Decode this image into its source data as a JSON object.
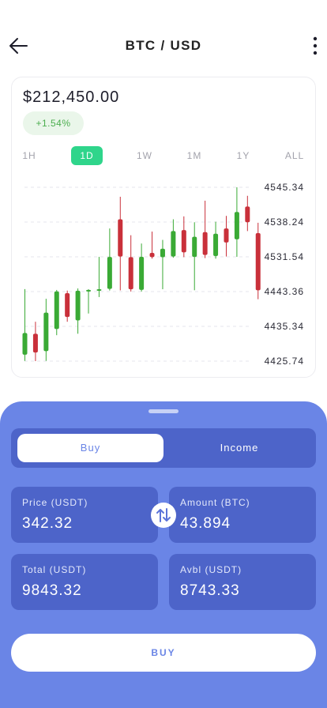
{
  "header": {
    "title": "BTC / USD",
    "back_icon": "arrow-left-icon",
    "more_icon": "vertical-dots-icon"
  },
  "market": {
    "price": "$212,450.00",
    "change": "+1.54%"
  },
  "timeframes": {
    "items": [
      "1H",
      "1D",
      "1W",
      "1M",
      "1Y",
      "ALL"
    ],
    "selected": "1D"
  },
  "chart_data": {
    "type": "candlestick",
    "y_ticks": [
      "4545.34",
      "4538.24",
      "4531.54",
      "4443.36",
      "4435.34",
      "4425.74"
    ],
    "candles": [
      {
        "o": 4427.5,
        "c": 4433.5,
        "h": 4449.5,
        "l": 4425.8,
        "dir": "up"
      },
      {
        "o": 4433.3,
        "c": 4428.1,
        "h": 4436.4,
        "l": 4425.3,
        "dir": "down"
      },
      {
        "o": 4428.5,
        "c": 4438.5,
        "h": 4441.7,
        "l": 4425.8,
        "dir": "up"
      },
      {
        "o": 4434.6,
        "c": 4443.8,
        "h": 4447.5,
        "l": 4432.9,
        "dir": "up"
      },
      {
        "o": 4443.0,
        "c": 4437.5,
        "h": 4445.9,
        "l": 4436.4,
        "dir": "down"
      },
      {
        "o": 4436.7,
        "c": 4445.7,
        "h": 4451.3,
        "l": 4433.3,
        "dir": "up"
      },
      {
        "o": 4443.9,
        "c": 4447.5,
        "h": 4449.3,
        "l": 4438.3,
        "dir": "up"
      },
      {
        "o": 4445.8,
        "c": 4449.3,
        "h": 4531.4,
        "l": 4442.1,
        "dir": "up"
      },
      {
        "o": 4450.2,
        "c": 4531.3,
        "h": 4537.0,
        "l": 4446.0,
        "dir": "up"
      },
      {
        "o": 4538.8,
        "c": 4531.6,
        "h": 4543.4,
        "l": 4446.4,
        "dir": "down"
      },
      {
        "o": 4530.9,
        "c": 4449.2,
        "h": 4535.7,
        "l": 4443.4,
        "dir": "down"
      },
      {
        "o": 4447.7,
        "c": 4531.5,
        "h": 4534.1,
        "l": 4443.4,
        "dir": "up"
      },
      {
        "o": 4530.9,
        "c": 4532.3,
        "h": 4536.4,
        "l": 4526.9,
        "dir": "down"
      },
      {
        "o": 4530.5,
        "c": 4533.1,
        "h": 4534.8,
        "l": 4449.3,
        "dir": "up"
      },
      {
        "o": 4531.6,
        "c": 4536.5,
        "h": 4538.8,
        "l": 4529.2,
        "dir": "up"
      },
      {
        "o": 4536.7,
        "c": 4532.4,
        "h": 4539.4,
        "l": 4530.7,
        "dir": "down"
      },
      {
        "o": 4531.4,
        "c": 4535.4,
        "h": 4538.2,
        "l": 4446.8,
        "dir": "up"
      },
      {
        "o": 4536.3,
        "c": 4531.9,
        "h": 4542.6,
        "l": 4528.3,
        "dir": "down"
      },
      {
        "o": 4531.7,
        "c": 4536.0,
        "h": 4538.3,
        "l": 4526.8,
        "dir": "up"
      },
      {
        "o": 4537.0,
        "c": 4534.3,
        "h": 4539.5,
        "l": 4531.6,
        "dir": "down"
      },
      {
        "o": 4534.9,
        "c": 4540.3,
        "h": 4545.8,
        "l": 4531.5,
        "dir": "up"
      },
      {
        "o": 4541.4,
        "c": 4538.2,
        "h": 4543.6,
        "l": 4536.5,
        "dir": "down"
      },
      {
        "o": 4536.1,
        "c": 4446.6,
        "h": 4538.1,
        "l": 4441.6,
        "dir": "down"
      }
    ],
    "colors": {
      "up": "#3aaa35",
      "down": "#c9303a"
    },
    "grid": "dashed"
  },
  "trade": {
    "tabs": [
      {
        "label": "Buy",
        "active": true
      },
      {
        "label": "Income",
        "active": false
      }
    ],
    "fields": {
      "price": {
        "label": "Price (USDT)",
        "value": "342.32"
      },
      "amount": {
        "label": "Amount (BTC)",
        "value": "43.894"
      },
      "total": {
        "label": "Total (USDT)",
        "value": "9843.32"
      },
      "avbl": {
        "label": "Avbl (USDT)",
        "value": "8743.33"
      }
    },
    "swap_icon": "swap-arrows-icon",
    "buy_label": "BUY"
  },
  "colors": {
    "accent_green": "#2fd58b",
    "sheet_blue": "#6a85e6",
    "panel_blue": "#4d64c9"
  }
}
